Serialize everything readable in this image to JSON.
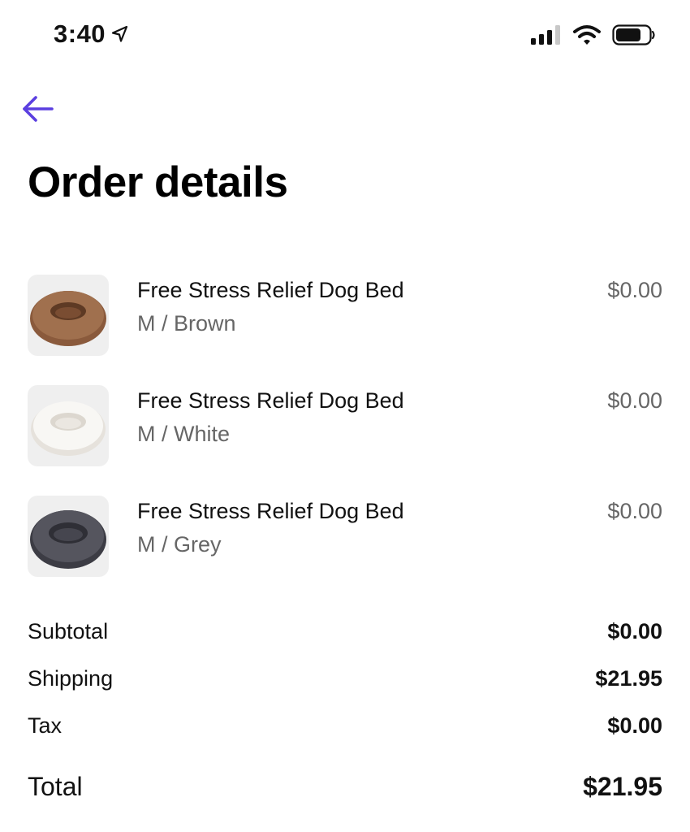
{
  "status_bar": {
    "time": "3:40",
    "icons": [
      "location-arrow-icon",
      "signal-icon",
      "wifi-icon",
      "battery-icon"
    ]
  },
  "nav": {
    "back_icon": "back-arrow-icon",
    "accent_color": "#5B3FE0"
  },
  "page": {
    "title": "Order details"
  },
  "items": [
    {
      "name": "Free Stress Relief Dog Bed",
      "variant": "M / Brown",
      "price": "$0.00",
      "color": "#8a5a3c"
    },
    {
      "name": "Free Stress Relief Dog Bed",
      "variant": "M / White",
      "price": "$0.00",
      "color": "#f3f1ee"
    },
    {
      "name": "Free Stress Relief Dog Bed",
      "variant": "M / Grey",
      "price": "$0.00",
      "color": "#4a4a52"
    }
  ],
  "summary": {
    "subtotal_label": "Subtotal",
    "subtotal_value": "$0.00",
    "shipping_label": "Shipping",
    "shipping_value": "$21.95",
    "tax_label": "Tax",
    "tax_value": "$0.00",
    "total_label": "Total",
    "total_value": "$21.95"
  }
}
